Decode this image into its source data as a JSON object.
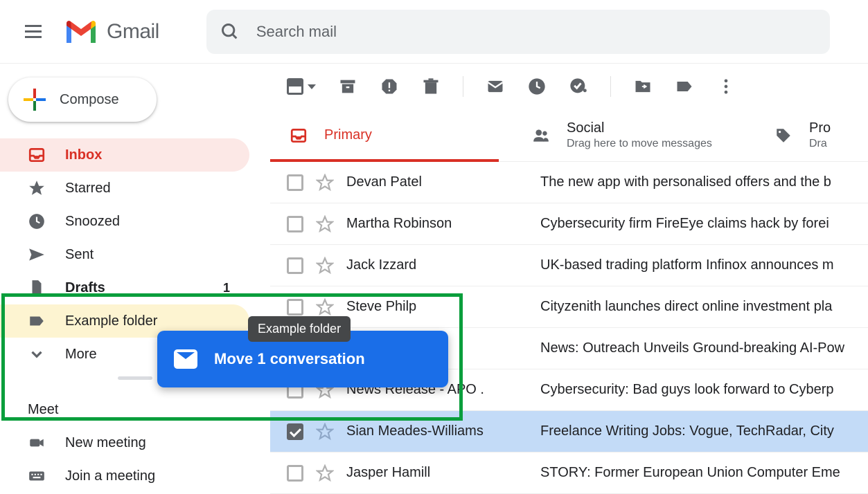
{
  "app": {
    "name": "Gmail"
  },
  "search": {
    "placeholder": "Search mail"
  },
  "compose": {
    "label": "Compose"
  },
  "sidebar": {
    "items": [
      {
        "label": "Inbox",
        "count": ""
      },
      {
        "label": "Starred"
      },
      {
        "label": "Snoozed"
      },
      {
        "label": "Sent"
      },
      {
        "label": "Drafts",
        "count": "1"
      },
      {
        "label": "Example folder"
      },
      {
        "label": "More"
      }
    ]
  },
  "meet": {
    "title": "Meet",
    "items": [
      {
        "label": "New meeting"
      },
      {
        "label": "Join a meeting"
      }
    ]
  },
  "tabs": [
    {
      "label": "Primary"
    },
    {
      "label": "Social",
      "sub": "Drag here to move messages"
    },
    {
      "label": "Pro",
      "sub": "Dra"
    }
  ],
  "emails": [
    {
      "sender": "Devan Patel",
      "subject": "The new app with personalised offers and the b"
    },
    {
      "sender": "Martha Robinson",
      "subject": "Cybersecurity firm FireEye claims hack by forei"
    },
    {
      "sender": "Jack Izzard",
      "subject": "UK-based trading platform Infinox announces m"
    },
    {
      "sender": "Steve Philp",
      "subject": "Cityzenith launches direct online investment pla"
    },
    {
      "sender": "",
      "subject": "News: Outreach Unveils Ground-breaking AI-Pow"
    },
    {
      "sender": "News Release - APO .",
      "subject": "Cybersecurity: Bad guys look forward to Cyberp"
    },
    {
      "sender": "Sian Meades-Williams",
      "subject": "Freelance Writing Jobs: Vogue, TechRadar, City"
    },
    {
      "sender": "Jasper Hamill",
      "subject": "STORY: Former European Union Computer Eme"
    }
  ],
  "drag": {
    "tooltip": "Example folder",
    "label": "Move 1 conversation"
  }
}
